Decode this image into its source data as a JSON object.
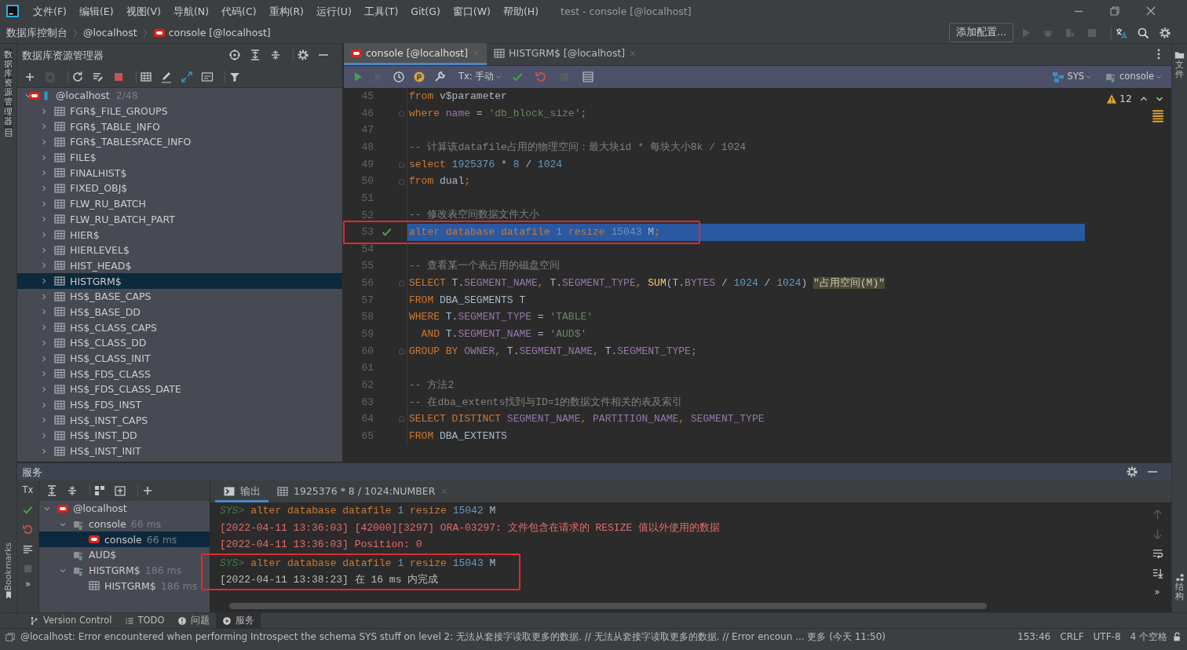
{
  "menu_bar": {
    "items": [
      "文件(F)",
      "编辑(E)",
      "视图(V)",
      "导航(N)",
      "代码(C)",
      "重构(R)",
      "运行(U)",
      "工具(T)",
      "Git(G)",
      "窗口(W)",
      "帮助(H)"
    ],
    "title": "test - console [@localhost]"
  },
  "navigation_bar": {
    "breadcrumbs": [
      "数据库控制台",
      "@localhost",
      "console [@localhost]"
    ],
    "config_button": "添加配置..."
  },
  "side_tabs": {
    "left": [
      "数据库资源管理器",
      "Bookmarks"
    ],
    "right": [
      "文件",
      "结构"
    ]
  },
  "database_explorer": {
    "title": "数据库资源管理器",
    "tree": [
      {
        "label": "@localhost",
        "count": "2/48",
        "kind": "datasource",
        "expanded": true,
        "selected": false,
        "children": [
          {
            "label": "FGR$_FILE_GROUPS",
            "kind": "table",
            "expanded": false,
            "selected": false
          },
          {
            "label": "FGR$_TABLE_INFO",
            "kind": "table",
            "expanded": false,
            "selected": false
          },
          {
            "label": "FGR$_TABLESPACE_INFO",
            "kind": "table",
            "expanded": false,
            "selected": false
          },
          {
            "label": "FILE$",
            "kind": "table",
            "expanded": false,
            "selected": false
          },
          {
            "label": "FINALHIST$",
            "kind": "table",
            "expanded": false,
            "selected": false
          },
          {
            "label": "FIXED_OBJ$",
            "kind": "table",
            "expanded": false,
            "selected": false
          },
          {
            "label": "FLW_RU_BATCH",
            "kind": "table",
            "expanded": false,
            "selected": false
          },
          {
            "label": "FLW_RU_BATCH_PART",
            "kind": "table",
            "expanded": false,
            "selected": false
          },
          {
            "label": "HIER$",
            "kind": "table",
            "expanded": false,
            "selected": false
          },
          {
            "label": "HIERLEVEL$",
            "kind": "table",
            "expanded": false,
            "selected": false
          },
          {
            "label": "HIST_HEAD$",
            "kind": "table",
            "expanded": false,
            "selected": false
          },
          {
            "label": "HISTGRM$",
            "kind": "table",
            "expanded": false,
            "selected": true
          },
          {
            "label": "HS$_BASE_CAPS",
            "kind": "table",
            "expanded": false,
            "selected": false
          },
          {
            "label": "HS$_BASE_DD",
            "kind": "table",
            "expanded": false,
            "selected": false
          },
          {
            "label": "HS$_CLASS_CAPS",
            "kind": "table",
            "expanded": false,
            "selected": false
          },
          {
            "label": "HS$_CLASS_DD",
            "kind": "table",
            "expanded": false,
            "selected": false
          },
          {
            "label": "HS$_CLASS_INIT",
            "kind": "table",
            "expanded": false,
            "selected": false
          },
          {
            "label": "HS$_FDS_CLASS",
            "kind": "table",
            "expanded": false,
            "selected": false
          },
          {
            "label": "HS$_FDS_CLASS_DATE",
            "kind": "table",
            "expanded": false,
            "selected": false
          },
          {
            "label": "HS$_FDS_INST",
            "kind": "table",
            "expanded": false,
            "selected": false
          },
          {
            "label": "HS$_INST_CAPS",
            "kind": "table",
            "expanded": false,
            "selected": false
          },
          {
            "label": "HS$_INST_DD",
            "kind": "table",
            "expanded": false,
            "selected": false
          },
          {
            "label": "HS$_INST_INIT",
            "kind": "table",
            "expanded": false,
            "selected": false
          }
        ]
      }
    ]
  },
  "editor": {
    "tabs": [
      {
        "label": "console [@localhost]",
        "kind": "console",
        "selected": true
      },
      {
        "label": "HISTGRM$ [@localhost]",
        "kind": "table",
        "selected": false
      }
    ],
    "toolbar": {
      "transaction": "Tx: 手动",
      "schema": "SYS",
      "session": "console"
    },
    "warning_count": "12",
    "lines": [
      {
        "number": "45",
        "selected": false,
        "tokens": [
          {
            "text": "from",
            "kind": "keyword"
          },
          {
            "text": " v$parameter",
            "kind": "ident"
          }
        ]
      },
      {
        "number": "46",
        "selected": false,
        "fold_marker": true,
        "tokens": [
          {
            "text": "where",
            "kind": "keyword"
          },
          {
            "text": " name",
            "kind": "column"
          },
          {
            "text": " = ",
            "kind": "ident"
          },
          {
            "text": "'db_block_size'",
            "kind": "string"
          },
          {
            "text": ";",
            "kind": "keyword"
          }
        ]
      },
      {
        "number": "47",
        "selected": false
      },
      {
        "number": "48",
        "selected": false,
        "tokens": [
          {
            "text": "-- 计算该datafile占用的物理空间：最大块id * 每块大小8k / 1024",
            "kind": "comment"
          }
        ]
      },
      {
        "number": "49",
        "selected": false,
        "fold_marker": true,
        "tokens": [
          {
            "text": "select",
            "kind": "keyword"
          },
          {
            "text": " 1925376",
            "kind": "number"
          },
          {
            "text": " * ",
            "kind": "ident"
          },
          {
            "text": "8",
            "kind": "number"
          },
          {
            "text": " / ",
            "kind": "ident"
          },
          {
            "text": "1024",
            "kind": "number"
          }
        ]
      },
      {
        "number": "50",
        "selected": false,
        "fold_marker": true,
        "tokens": [
          {
            "text": "from",
            "kind": "keyword"
          },
          {
            "text": " dual",
            "kind": "ident"
          },
          {
            "text": ";",
            "kind": "keyword"
          }
        ]
      },
      {
        "number": "51",
        "selected": false
      },
      {
        "number": "52",
        "selected": false,
        "tokens": [
          {
            "text": "-- 修改表空间数据文件大小",
            "kind": "comment"
          }
        ]
      },
      {
        "number": "53",
        "selected": true,
        "executed": true,
        "annotated": true,
        "tokens": [
          {
            "text": "alter database datafile ",
            "kind": "keyword"
          },
          {
            "text": "1",
            "kind": "number"
          },
          {
            "text": " resize ",
            "kind": "keyword"
          },
          {
            "text": "15043",
            "kind": "number"
          },
          {
            "text": " M",
            "kind": "ident"
          },
          {
            "text": ";",
            "kind": "keyword"
          }
        ]
      },
      {
        "number": "54",
        "selected": false
      },
      {
        "number": "55",
        "selected": false,
        "tokens": [
          {
            "text": "-- 查看某一个表占用的磁盘空间",
            "kind": "comment"
          }
        ]
      },
      {
        "number": "56",
        "selected": false,
        "fold_marker": true,
        "tokens": [
          {
            "text": "SELECT",
            "kind": "keyword"
          },
          {
            "text": " T.",
            "kind": "ident"
          },
          {
            "text": "SEGMENT_NAME",
            "kind": "column"
          },
          {
            "text": ", ",
            "kind": "keyword"
          },
          {
            "text": "T.",
            "kind": "ident"
          },
          {
            "text": "SEGMENT_TYPE",
            "kind": "column"
          },
          {
            "text": ", ",
            "kind": "keyword"
          },
          {
            "text": "SUM",
            "kind": "function"
          },
          {
            "text": "(T.",
            "kind": "ident"
          },
          {
            "text": "BYTES",
            "kind": "column"
          },
          {
            "text": " / ",
            "kind": "ident"
          },
          {
            "text": "1024",
            "kind": "number"
          },
          {
            "text": " / ",
            "kind": "ident"
          },
          {
            "text": "1024",
            "kind": "number"
          },
          {
            "text": ") ",
            "kind": "ident"
          },
          {
            "text": "\"占用空间(M)\"",
            "kind": "alias"
          }
        ]
      },
      {
        "number": "57",
        "selected": false,
        "tokens": [
          {
            "text": "FROM",
            "kind": "keyword"
          },
          {
            "text": " DBA_SEGMENTS T",
            "kind": "ident"
          }
        ]
      },
      {
        "number": "58",
        "selected": false,
        "tokens": [
          {
            "text": "WHERE",
            "kind": "keyword"
          },
          {
            "text": " T.",
            "kind": "ident"
          },
          {
            "text": "SEGMENT_TYPE",
            "kind": "column"
          },
          {
            "text": " = ",
            "kind": "ident"
          },
          {
            "text": "'TABLE'",
            "kind": "string"
          }
        ]
      },
      {
        "number": "59",
        "selected": false,
        "tokens": [
          {
            "text": "  AND",
            "kind": "keyword"
          },
          {
            "text": " T.",
            "kind": "ident"
          },
          {
            "text": "SEGMENT_NAME",
            "kind": "column"
          },
          {
            "text": " = ",
            "kind": "ident"
          },
          {
            "text": "'AUD$'",
            "kind": "string"
          }
        ]
      },
      {
        "number": "60",
        "selected": false,
        "fold_marker": true,
        "tokens": [
          {
            "text": "GROUP BY ",
            "kind": "keyword"
          },
          {
            "text": "OWNER",
            "kind": "column"
          },
          {
            "text": ", ",
            "kind": "keyword"
          },
          {
            "text": "T.",
            "kind": "ident"
          },
          {
            "text": "SEGMENT_NAME",
            "kind": "column"
          },
          {
            "text": ", ",
            "kind": "keyword"
          },
          {
            "text": "T.",
            "kind": "ident"
          },
          {
            "text": "SEGMENT_TYPE",
            "kind": "column"
          },
          {
            "text": ";",
            "kind": "keyword"
          }
        ]
      },
      {
        "number": "61",
        "selected": false
      },
      {
        "number": "62",
        "selected": false,
        "tokens": [
          {
            "text": "-- 方法2",
            "kind": "comment"
          }
        ]
      },
      {
        "number": "63",
        "selected": false,
        "tokens": [
          {
            "text": "-- 在dba_extents找到与ID=1的数据文件相关的表及索引",
            "kind": "comment"
          }
        ]
      },
      {
        "number": "64",
        "selected": false,
        "fold_marker": true,
        "tokens": [
          {
            "text": "SELECT DISTINCT ",
            "kind": "keyword"
          },
          {
            "text": "SEGMENT_NAME",
            "kind": "column"
          },
          {
            "text": ", ",
            "kind": "keyword"
          },
          {
            "text": "PARTITION_NAME",
            "kind": "column"
          },
          {
            "text": ", ",
            "kind": "keyword"
          },
          {
            "text": "SEGMENT_TYPE",
            "kind": "column"
          }
        ]
      },
      {
        "number": "65",
        "selected": false,
        "tokens": [
          {
            "text": "FROM",
            "kind": "keyword"
          },
          {
            "text": " DBA_EXTENTS",
            "kind": "ident"
          }
        ]
      }
    ]
  },
  "services": {
    "title": "服务",
    "toolbar": {
      "transaction": "Tx",
      "more": "»"
    },
    "tree": [
      {
        "label": "@localhost",
        "kind": "datasource",
        "expanded": true,
        "selected": false,
        "children": [
          {
            "label": "console",
            "time": "66 ms",
            "kind": "session",
            "expanded": true,
            "selected": false,
            "children": [
              {
                "label": "console",
                "time": "66 ms",
                "kind": "console",
                "selected": true
              }
            ]
          },
          {
            "label": "AUD$",
            "kind": "session",
            "selected": false
          },
          {
            "label": "HISTGRM$",
            "time": "186 ms",
            "kind": "session",
            "expanded": true,
            "selected": false,
            "children": [
              {
                "label": "HISTGRM$",
                "time": "186 ms",
                "kind": "table",
                "selected": false
              }
            ]
          }
        ]
      }
    ],
    "output_tabs": [
      {
        "label": "输出",
        "kind": "output",
        "selected": true
      },
      {
        "label": "1925376 * 8 / 1024:NUMBER",
        "kind": "table",
        "selected": false
      }
    ],
    "output": [
      {
        "kind": "command",
        "prompt": "SYS>",
        "annotated": false,
        "tokens": [
          {
            "text": "alter database datafile ",
            "kind": "keyword"
          },
          {
            "text": "1",
            "kind": "number"
          },
          {
            "text": " resize ",
            "kind": "keyword"
          },
          {
            "text": "15042",
            "kind": "number"
          },
          {
            "text": " M",
            "kind": "ident"
          }
        ]
      },
      {
        "kind": "error",
        "annotated": false,
        "text": "[2022-04-11 13:36:03] [42000][3297] ORA-03297: 文件包含在请求的 RESIZE 值以外使用的数据"
      },
      {
        "kind": "error",
        "annotated": false,
        "text": "[2022-04-11 13:36:03] Position: 0"
      },
      {
        "kind": "command",
        "prompt": "SYS>",
        "annotated": true,
        "tokens": [
          {
            "text": "alter database datafile ",
            "kind": "keyword"
          },
          {
            "text": "1",
            "kind": "number"
          },
          {
            "text": " resize ",
            "kind": "keyword"
          },
          {
            "text": "15043",
            "kind": "number"
          },
          {
            "text": " M",
            "kind": "ident"
          }
        ]
      },
      {
        "kind": "info",
        "annotated": true,
        "text": "[2022-04-11 13:38:23] 在 16 ms 内完成"
      }
    ],
    "side_more": "»"
  },
  "tool_windows": [
    {
      "label": "Version Control",
      "selected": false
    },
    {
      "label": "TODO",
      "selected": false
    },
    {
      "label": "问题",
      "selected": false
    },
    {
      "label": "服务",
      "selected": true
    }
  ],
  "status_bar": {
    "message": "@localhost: Error encountered when performing Introspect the schema SYS stuff on level 2: 无法从套接字读取更多的数据. // 无法从套接字读取更多的数据. // Error encoun ... 更多 (今天 11:50)",
    "position": "153:46",
    "line_separator": "CRLF",
    "encoding": "UTF-8",
    "indent": "4 个空格"
  }
}
